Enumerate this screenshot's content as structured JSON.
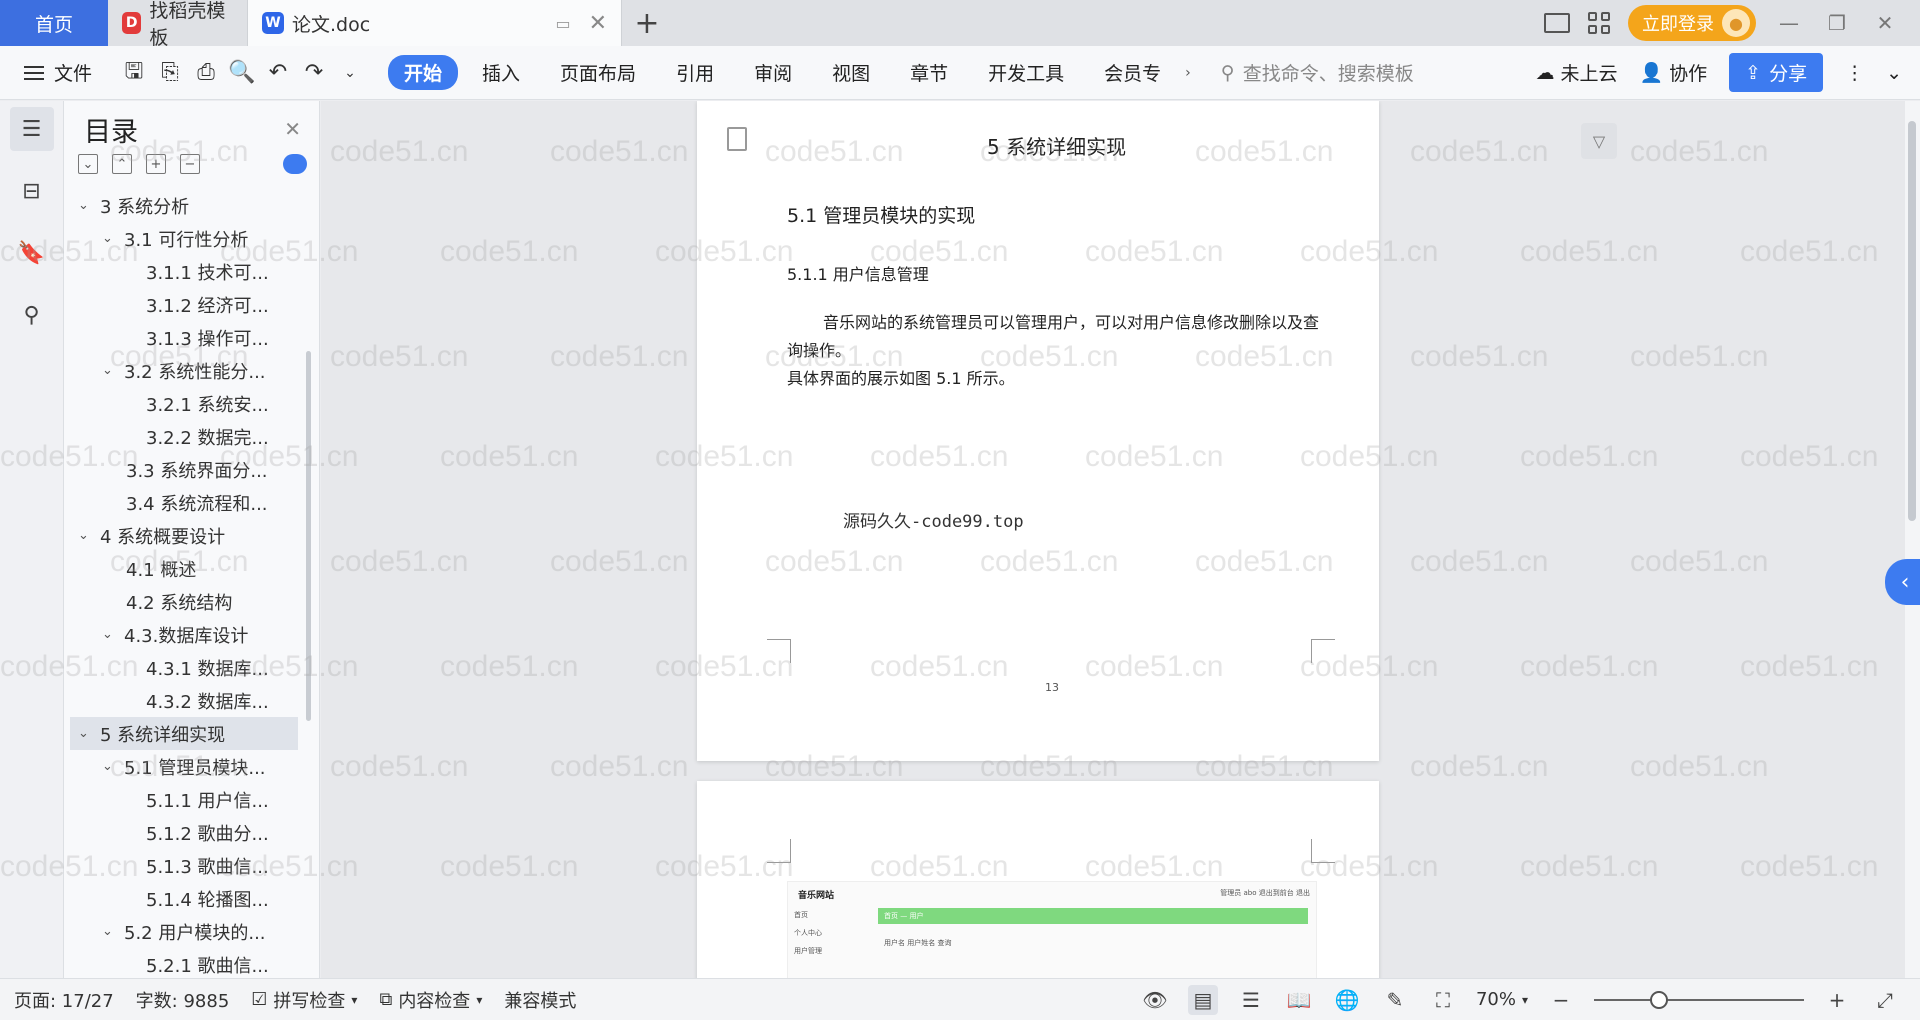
{
  "tabs": {
    "home": "首页",
    "template": "找稻壳模板",
    "doc": "论文.doc"
  },
  "topright": {
    "login": "立即登录"
  },
  "ribbon": {
    "file": "文件",
    "tabs": [
      "开始",
      "插入",
      "页面布局",
      "引用",
      "审阅",
      "视图",
      "章节",
      "开发工具",
      "会员专"
    ],
    "search_placeholder": "查找命令、搜索模板",
    "cloud": "未上云",
    "collab": "协作",
    "share": "分享"
  },
  "outline": {
    "title": "目录",
    "items": [
      {
        "text": "3 系统分析",
        "level": 0,
        "chev": true
      },
      {
        "text": "3.1 可行性分析",
        "level": 1,
        "chev": true
      },
      {
        "text": "3.1.1 技术可...",
        "level": 2,
        "chev": false
      },
      {
        "text": "3.1.2 经济可...",
        "level": 2,
        "chev": false
      },
      {
        "text": "3.1.3 操作可...",
        "level": 2,
        "chev": false
      },
      {
        "text": "3.2 系统性能分...",
        "level": 1,
        "chev": true
      },
      {
        "text": "3.2.1  系统安...",
        "level": 2,
        "chev": false
      },
      {
        "text": "3.2.2  数据完...",
        "level": 2,
        "chev": false
      },
      {
        "text": "3.3 系统界面分...",
        "level": 1,
        "chev": false
      },
      {
        "text": "3.4 系统流程和...",
        "level": 1,
        "chev": false
      },
      {
        "text": "4 系统概要设计",
        "level": 0,
        "chev": true
      },
      {
        "text": "4.1 概述",
        "level": 1,
        "chev": false
      },
      {
        "text": "4.2 系统结构",
        "level": 1,
        "chev": false
      },
      {
        "text": "4.3.数据库设计",
        "level": 1,
        "chev": true
      },
      {
        "text": "4.3.1 数据库...",
        "level": 2,
        "chev": false
      },
      {
        "text": "4.3.2 数据库...",
        "level": 2,
        "chev": false
      },
      {
        "text": "5 系统详细实现",
        "level": 0,
        "chev": true,
        "selected": true
      },
      {
        "text": "5.1  管理员模块...",
        "level": 1,
        "chev": true
      },
      {
        "text": "5.1.1  用户信...",
        "level": 2,
        "chev": false
      },
      {
        "text": "5.1.2  歌曲分...",
        "level": 2,
        "chev": false
      },
      {
        "text": "5.1.3  歌曲信...",
        "level": 2,
        "chev": false
      },
      {
        "text": "5.1.4  轮播图...",
        "level": 2,
        "chev": false
      },
      {
        "text": "5.2  用户模块的...",
        "level": 1,
        "chev": true
      },
      {
        "text": "5.2.1  歌曲信...",
        "level": 2,
        "chev": false
      }
    ]
  },
  "document": {
    "header": "5 系统详细实现",
    "h1": "5.1  管理员模块的实现",
    "h2": "5.1.1  用户信息管理",
    "para": "音乐网站的系统管理员可以管理用户，可以对用户信息修改删除以及查询操作。",
    "para2": "具体界面的展示如图 5.1 所示。",
    "source": "源码久久-code99.top",
    "page_number": "13",
    "mini_app": {
      "brand": "音乐网站",
      "top": "管理员 abo   退出到前台   退出",
      "side": [
        "首页",
        "个人中心",
        "用户管理"
      ],
      "bar": "首页 — 用户",
      "form": "用户名  用户姓名  查询"
    }
  },
  "watermark": "code51.cn",
  "status": {
    "page": "页面: 17/27",
    "words": "字数: 9885",
    "spell": "拼写检查",
    "content": "内容检查",
    "compat": "兼容模式",
    "zoom": "70%"
  }
}
